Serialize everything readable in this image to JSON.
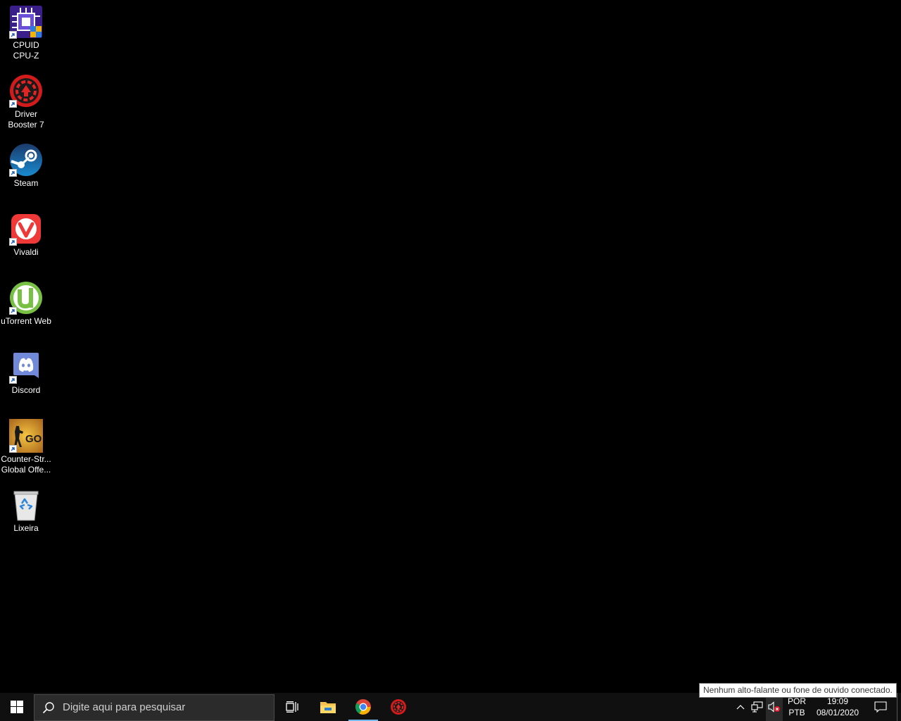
{
  "desktop": {
    "icons": [
      {
        "label": "CPUID\nCPU-Z",
        "icon": "cpu-z-icon"
      },
      {
        "label": "Driver\nBooster 7",
        "icon": "driver-booster-icon"
      },
      {
        "label": "Steam",
        "icon": "steam-icon"
      },
      {
        "label": "Vivaldi",
        "icon": "vivaldi-icon"
      },
      {
        "label": "uTorrent Web",
        "icon": "utorrent-icon"
      },
      {
        "label": "Discord",
        "icon": "discord-icon"
      },
      {
        "label": "Counter-Str...\nGlobal Offe...",
        "icon": "csgo-icon"
      },
      {
        "label": "Lixeira",
        "icon": "recycle-bin-icon"
      }
    ]
  },
  "taskbar": {
    "search_placeholder": "Digite aqui para pesquisar",
    "pinned": [
      "task-view-icon",
      "file-explorer-icon",
      "chrome-icon",
      "driver-booster-icon"
    ],
    "language_top": "POR",
    "language_bottom": "PTB",
    "time": "19:09",
    "date": "08/01/2020"
  },
  "tooltip": {
    "text": "Nenhum alto-falante ou fone de ouvido conectado."
  },
  "colors": {
    "desktop_bg": "#000000",
    "taskbar_bg": "#101010",
    "active_indicator": "#76b9ed"
  }
}
